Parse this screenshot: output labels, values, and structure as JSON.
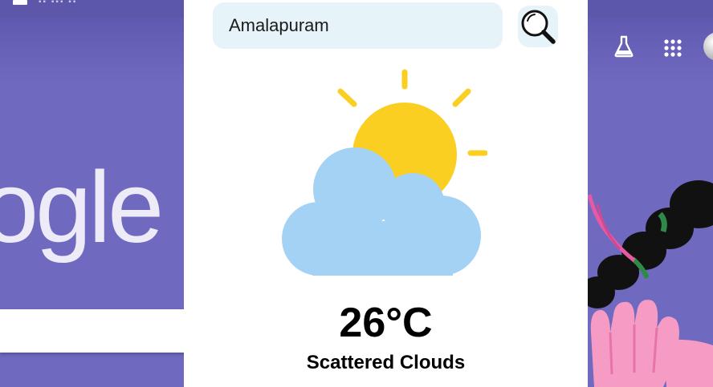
{
  "weather": {
    "city_input_value": "Amalapuram",
    "temperature": "26°C",
    "condition": "Scattered Clouds",
    "icon": "partly-cloudy-icon",
    "search_icon": "search-icon"
  },
  "background_page": {
    "logo_fragment": "ogle",
    "right_icons": [
      "labs-flask-icon",
      "apps-grid-icon",
      "account-avatar"
    ]
  },
  "colors": {
    "background": "#6f69c0",
    "popup": "#ffffff",
    "input_bg": "#e6f3f9",
    "sun": "#fbcf22",
    "cloud": "#a4d2f5"
  }
}
